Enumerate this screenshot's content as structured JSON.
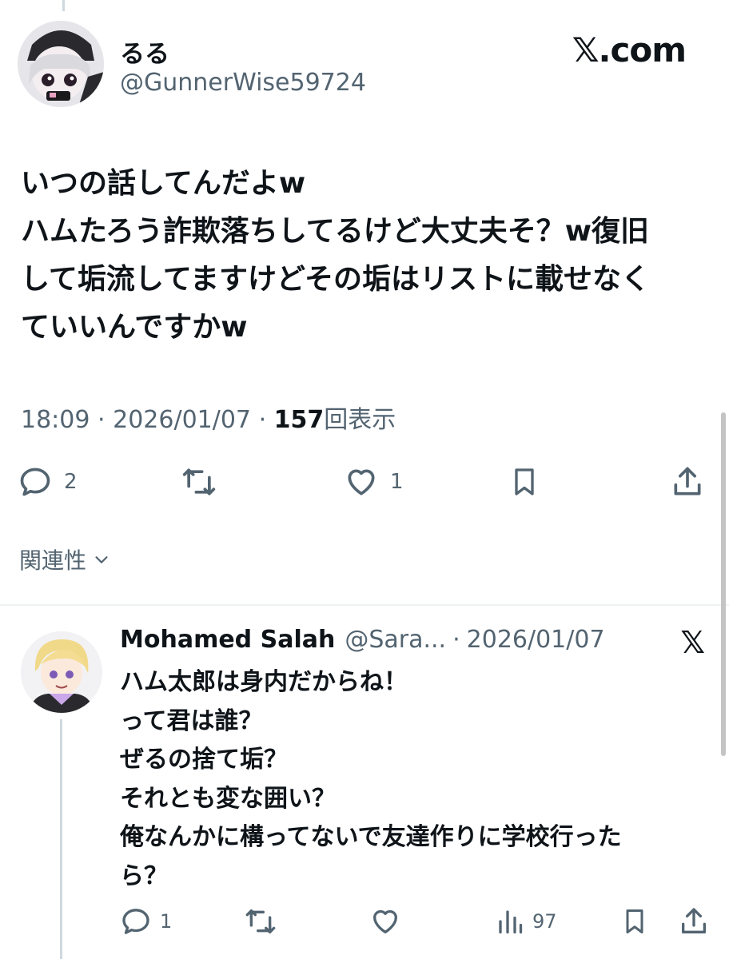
{
  "tweet": {
    "author_name": "るる",
    "author_handle": "@GunnerWise59724",
    "brand": "𝕏.com",
    "text": "いつの話してんだよw\nハムたろう詐欺落ちしてるけど大丈夫そ？w復旧\nして垢流してますけどその垢はリストに載せなく\nていいんですかw",
    "time": "18:09",
    "date": "2026/01/07",
    "views": "157",
    "views_label": "回表示",
    "separator": "·",
    "reply_count": "2",
    "like_count": "1"
  },
  "related": {
    "label": "関連性"
  },
  "reply": {
    "author_name": "Mohamed Salah",
    "author_handle": "@Sara...",
    "separator": "·",
    "date": "2026/01/07",
    "text": "ハム太郎は身内だからね！\nって君は誰？\nぜるの捨て垢？\nそれとも変な囲い？\n俺なんかに構ってないで友達作りに学校行った\nら？",
    "reply_count": "1",
    "views": "97"
  },
  "colors": {
    "text": "#0f1419",
    "secondary": "#536471",
    "divider": "#eff3f4",
    "thread": "#cfd9de"
  },
  "icons": [
    "reply-icon",
    "retweet-icon",
    "like-icon",
    "bookmark-icon",
    "share-icon",
    "views-icon",
    "chevron-down-icon",
    "x-logo-icon"
  ]
}
